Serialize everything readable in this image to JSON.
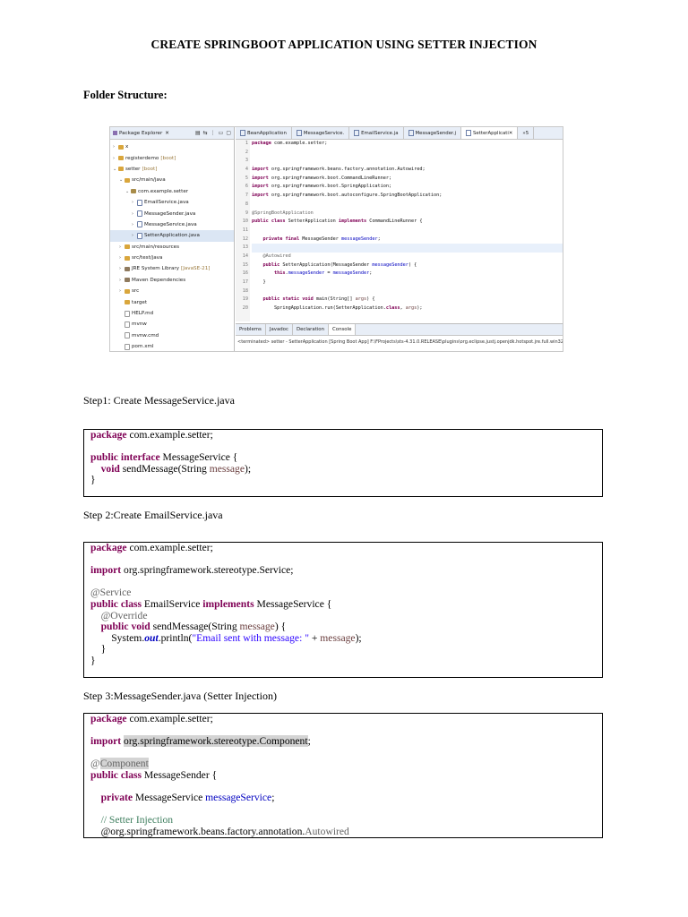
{
  "title": "CREATE SPRINGBOOT APPLICATION USING SETTER INJECTION",
  "folder_heading": "Folder Structure:",
  "ide": {
    "explorer_tab": "Package Explorer",
    "tree": [
      {
        "label": "x",
        "indent": 0,
        "icon": "folder",
        "arrow": ">"
      },
      {
        "label": "registerdemo",
        "tag": "[boot]",
        "indent": 0,
        "icon": "folder",
        "arrow": ">"
      },
      {
        "label": "setter",
        "tag": "[boot]",
        "indent": 0,
        "icon": "folder",
        "arrow": "v"
      },
      {
        "label": "src/main/java",
        "indent": 1,
        "icon": "folder",
        "arrow": "v"
      },
      {
        "label": "com.example.setter",
        "indent": 2,
        "icon": "pkg",
        "arrow": "v"
      },
      {
        "label": "EmailService.java",
        "indent": 3,
        "icon": "java",
        "arrow": ">"
      },
      {
        "label": "MessageSender.java",
        "indent": 3,
        "icon": "java",
        "arrow": ">"
      },
      {
        "label": "MessageService.java",
        "indent": 3,
        "icon": "java",
        "arrow": ">"
      },
      {
        "label": "SetterApplication.java",
        "indent": 3,
        "icon": "java",
        "arrow": ">",
        "selected": true
      },
      {
        "label": "src/main/resources",
        "indent": 1,
        "icon": "folder",
        "arrow": ">"
      },
      {
        "label": "src/test/java",
        "indent": 1,
        "icon": "folder",
        "arrow": ">"
      },
      {
        "label": "JRE System Library",
        "tag": "[JavaSE-21]",
        "indent": 1,
        "icon": "lib",
        "arrow": ">"
      },
      {
        "label": "Maven Dependencies",
        "indent": 1,
        "icon": "lib",
        "arrow": ">"
      },
      {
        "label": "src",
        "indent": 1,
        "icon": "folder",
        "arrow": ">"
      },
      {
        "label": "target",
        "indent": 1,
        "icon": "folder",
        "arrow": ""
      },
      {
        "label": "HELP.md",
        "indent": 1,
        "icon": "file",
        "arrow": ""
      },
      {
        "label": "mvnw",
        "indent": 1,
        "icon": "file",
        "arrow": ""
      },
      {
        "label": "mvnw.cmd",
        "indent": 1,
        "icon": "file",
        "arrow": ""
      },
      {
        "label": "pom.xml",
        "indent": 1,
        "icon": "file",
        "arrow": ""
      }
    ],
    "editor_tabs": [
      "BeanApplication",
      "MessageService.",
      "EmailService.ja",
      "MessageSender.j",
      "SetterApplicati"
    ],
    "editor_tab_overflow": "»5",
    "gutter": [
      "1",
      "2",
      "3",
      "4",
      "5",
      "6",
      "7",
      "8",
      "9",
      "10",
      "11",
      "12",
      "13",
      "14",
      "15",
      "16",
      "17",
      "18",
      "19",
      "20"
    ],
    "source_lines": [
      "package com.example.setter;",
      "",
      "",
      "import org.springframework.beans.factory.annotation.Autowired;",
      "import org.springframework.boot.CommandLineRunner;",
      "import org.springframework.boot.SpringApplication;",
      "import org.springframework.boot.autoconfigure.SpringBootApplication;",
      "",
      "@SpringBootApplication",
      "public class SetterApplication implements CommandLineRunner {",
      "",
      "    private final MessageSender messageSender;",
      "",
      "    @Autowired",
      "    public SetterApplication(MessageSender messageSender) {",
      "        this.messageSender = messageSender;",
      "    }",
      "",
      "    public static void main(String[] args) {",
      "        SpringApplication.run(SetterApplication.class, args);"
    ],
    "console_tabs": [
      "Problems",
      "Javadoc",
      "Declaration",
      "Console"
    ],
    "console_output": "<terminated> setter - SetterApplication [Spring Boot App] F:\\FProjects\\sts-4.31.0.RELEASE\\plugins\\org.eclipse.justj.openjdk.hotspot.jre.full.win32.x86_64_21."
  },
  "step1": {
    "label": "Step1: Create MessageService.java",
    "code": {
      "pkg_kw": "package",
      "pkg": " com.example.setter;",
      "l3_a": "public",
      "l3_b": " ",
      "l3_c": "interface",
      "l3_d": " MessageService {",
      "l4_a": "    ",
      "l4_kw": "void",
      "l4_b": " sendMessage(String ",
      "l4_var": "message",
      "l4_c": ");",
      "l5": "}"
    }
  },
  "step2": {
    "label": "Step 2:Create EmailService.java",
    "code": {
      "pkg_kw": "package",
      "pkg": " com.example.setter;",
      "imp_kw": "import",
      "imp": " org.springframework.stereotype.Service;",
      "ann": "@Service",
      "l6_a": "public",
      "l6_b": "class",
      "l6_c": " EmailService ",
      "l6_d": "implements",
      "l6_e": " MessageService {",
      "l7": "    @Override",
      "l8_a": "public",
      "l8_b": "void",
      "l8_c": " sendMessage(String ",
      "l8_var": "message",
      "l8_d": ") {",
      "l9_a": "        System.",
      "l9_out": "out",
      "l9_b": ".println(",
      "l9_str": "\"Email sent with message: \"",
      "l9_c": " + ",
      "l9_var": "message",
      "l9_d": ");",
      "l10": "    }",
      "l11": "}"
    }
  },
  "step3": {
    "label": "Step 3:MessageSender.java (Setter Injection)",
    "code": {
      "pkg_kw": "package",
      "pkg": " com.example.setter;",
      "imp_kw": "import",
      "imp": "org.springframework.stereotype.Component",
      "imp_end": ";",
      "ann_at": "@",
      "ann": "Component",
      "l6_a": "public",
      "l6_b": "class",
      "l6_c": " MessageSender {",
      "l8_kw": "private",
      "l8_b": " MessageService ",
      "l8_fld": "messageService",
      "l8_c": ";",
      "cmt": "    // Setter Injection",
      "l11_a": "    @org.springframework.beans.factory.annotation.",
      "l11_b": "Autowired"
    }
  }
}
